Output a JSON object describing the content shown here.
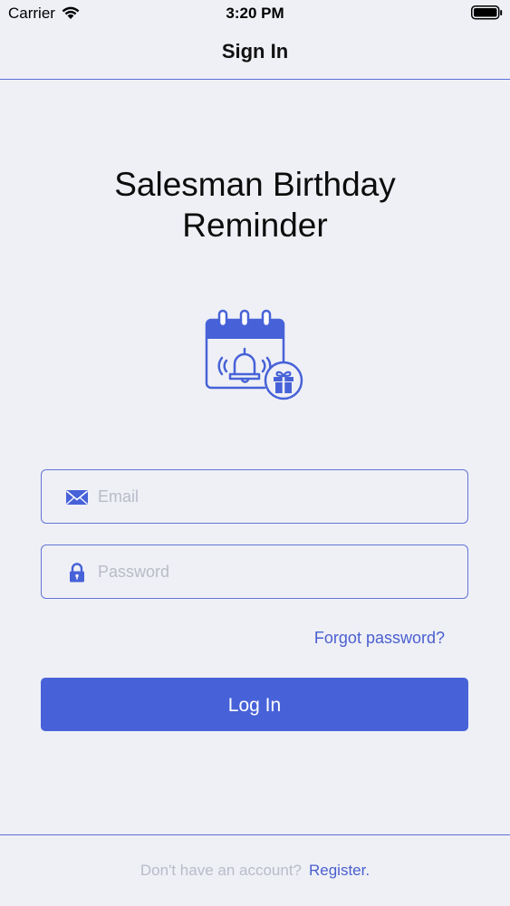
{
  "status_bar": {
    "carrier": "Carrier",
    "time": "3:20 PM",
    "wifi_icon": "wifi-icon",
    "battery_icon": "battery-icon"
  },
  "nav": {
    "title": "Sign In"
  },
  "app": {
    "title_line1": "Salesman Birthday",
    "title_line2": "Reminder",
    "logo_icon": "calendar-bell-gift-icon"
  },
  "form": {
    "email": {
      "placeholder": "Email",
      "value": "",
      "icon": "envelope-icon"
    },
    "password": {
      "placeholder": "Password",
      "value": "",
      "icon": "lock-icon"
    },
    "forgot_label": "Forgot password?",
    "login_label": "Log In"
  },
  "footer": {
    "prompt": "Don't have an account?",
    "register_label": "Register."
  },
  "colors": {
    "accent": "#4762d8",
    "background": "#eff0f6",
    "divider": "#5b70d8",
    "placeholder": "#b8bcc8"
  }
}
